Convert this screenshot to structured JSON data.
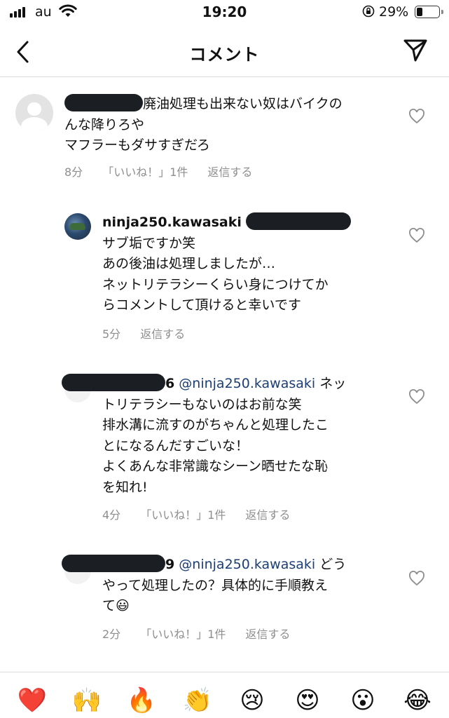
{
  "status_bar": {
    "carrier": "au",
    "time": "19:20",
    "battery_percent": "29%",
    "battery_level": 0.29,
    "icons": [
      "signal-icon",
      "wifi-icon",
      "orientation-lock-icon",
      "battery-icon"
    ]
  },
  "header": {
    "title": "コメント",
    "back_icon": "chevron-left-icon",
    "send_icon": "paper-plane-icon"
  },
  "comments": [
    {
      "username_redacted": true,
      "lines": [
        "廃油処理も出来ない奴はバイクの",
        "んな降りろや",
        "マフラーもダサすぎだろ"
      ],
      "time": "8分",
      "likes": "「いいね！」1件",
      "reply": "返信する"
    },
    {
      "username": "ninja250.kawasaki",
      "lines": [
        "サブ垢ですか笑",
        "あの後油は処理しましたが…",
        "ネットリテラシーくらい身につけてか",
        "らコメントして頂けると幸いです"
      ],
      "time": "5分",
      "reply": "返信する"
    },
    {
      "username_suffix": "6",
      "mention": "@ninja250.kawasaki",
      "first_line_rest": " ネッ",
      "lines": [
        "トリテラシーもないのはお前な笑",
        "排水溝に流すのがちゃんと処理したこ",
        "とになるんだすごいな！",
        "よくあんな非常識なシーン晒せたな恥",
        "を知れ!"
      ],
      "time": "4分",
      "likes": "「いいね！」1件",
      "reply": "返信する"
    },
    {
      "username_suffix": "9",
      "mention": "@ninja250.kawasaki",
      "first_line_rest": " どう",
      "lines": [
        "やって処理したの？具体的に手順教え",
        "て😃"
      ],
      "time": "2分",
      "likes": "「いいね！」1件",
      "reply": "返信する"
    }
  ],
  "emoji_bar": [
    "❤️",
    "🙌",
    "🔥",
    "👏",
    "😢",
    "😍",
    "😮",
    "😂"
  ]
}
